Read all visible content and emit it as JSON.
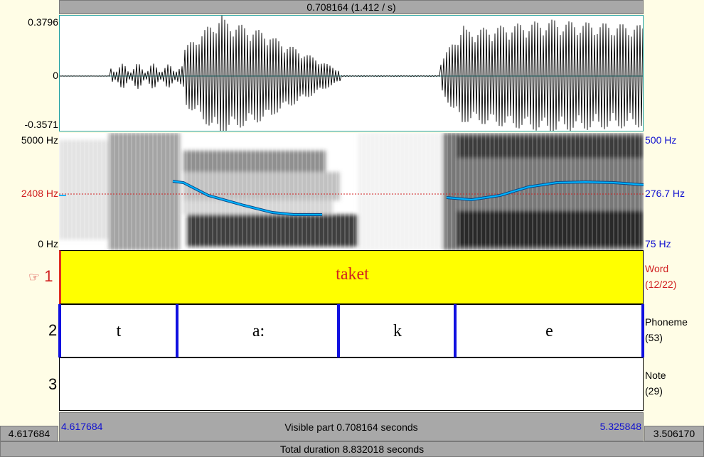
{
  "top_bar": {
    "selection_text": "0.708164 (1.412 / s)"
  },
  "waveform": {
    "max_label": "0.3796",
    "zero_label": "0",
    "min_label": "-0.3571"
  },
  "spectrogram": {
    "top_freq_label": "5000 Hz",
    "cursor_freq_label": "2408 Hz",
    "bottom_freq_label": "0 Hz",
    "pitch_top_label": "500 Hz",
    "pitch_cursor_label": "276.7 Hz",
    "pitch_bottom_label": "75 Hz",
    "pitch_color": "#00aaff"
  },
  "tiers": [
    {
      "number": "1",
      "pointer_icon": "☞",
      "name": "Word",
      "count": "(12/22)",
      "intervals": [
        "taket"
      ],
      "selected": true,
      "color": "#ffff00"
    },
    {
      "number": "2",
      "name": "Phoneme",
      "count": "(53)",
      "intervals": [
        "t",
        "a:",
        "k",
        "e"
      ],
      "selected": false
    },
    {
      "number": "3",
      "name": "Note",
      "count": "(29)",
      "intervals": [],
      "selected": false
    }
  ],
  "bottom": {
    "left_outside_time": "4.617684",
    "visible_start": "4.617684",
    "visible_text": "Visible part 0.708164 seconds",
    "visible_end": "5.325848",
    "right_outside_time": "3.506170",
    "total_text": "Total duration 8.832018 seconds"
  }
}
